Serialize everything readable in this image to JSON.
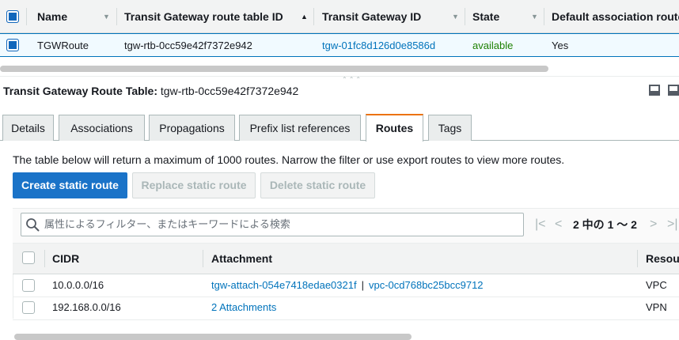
{
  "top_table": {
    "columns": [
      "Name",
      "Transit Gateway route table ID",
      "Transit Gateway ID",
      "State",
      "Default association route t"
    ],
    "row": {
      "name": "TGWRoute",
      "route_table_id": "tgw-rtb-0cc59e42f7372e942",
      "tgw_id": "tgw-01fc8d126d0e8586d",
      "state": "available",
      "default_association": "Yes"
    }
  },
  "panel": {
    "title_label": "Transit Gateway Route Table:",
    "title_value": "tgw-rtb-0cc59e42f7372e942"
  },
  "tabs": [
    "Details",
    "Associations",
    "Propagations",
    "Prefix list references",
    "Routes",
    "Tags"
  ],
  "active_tab": "Routes",
  "routes": {
    "info": "The table below will return a maximum of 1000 routes. Narrow the filter or use export routes to view more routes.",
    "buttons": {
      "create": "Create static route",
      "replace": "Replace static route",
      "delete": "Delete static route"
    },
    "search_placeholder": "属性によるフィルター、またはキーワードによる検索",
    "pagination": "2 中の 1 ～ 2",
    "columns": [
      "CIDR",
      "Attachment",
      "Resour"
    ],
    "rows": [
      {
        "cidr": "10.0.0.0/16",
        "attachment": "tgw-attach-054e7418edae0321f",
        "separator": "|",
        "attachment2": "vpc-0cd768bc25bcc9712",
        "resource": "VPC"
      },
      {
        "cidr": "192.168.0.0/16",
        "attachment": "2 Attachments",
        "resource": "VPN"
      }
    ]
  },
  "colors": {
    "link": "#0073bb",
    "available": "#1d8102",
    "primary_button": "#1a73c8",
    "active_tab_accent": "#ec7211"
  }
}
